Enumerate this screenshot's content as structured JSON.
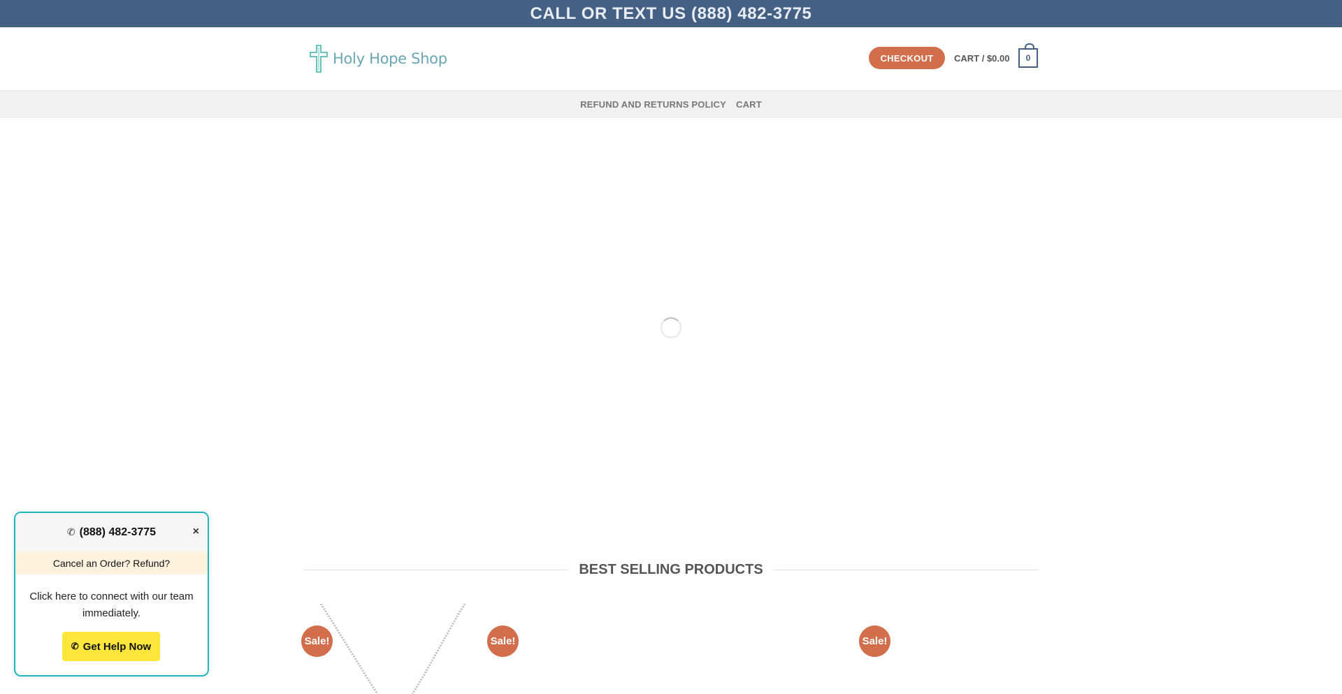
{
  "topbar": {
    "text": "CALL OR TEXT US (888) 482-3775"
  },
  "header": {
    "logo_text": "Holy Hope Shop",
    "checkout_label": "CHECKOUT",
    "cart_label": "CART / $0.00",
    "cart_count": "0"
  },
  "nav": {
    "items": [
      {
        "label": "REFUND AND RETURNS POLICY"
      },
      {
        "label": "CART"
      }
    ]
  },
  "best_selling": {
    "title": "BEST SELLING PRODUCTS",
    "sale_badges": [
      "Sale!",
      "Sale!",
      "Sale!"
    ]
  },
  "help_widget": {
    "phone": "(888) 482-3775",
    "close_label": "×",
    "subtitle": "Cancel an Order? Refund?",
    "body": "Click here to connect with our team immediately.",
    "button_label": "Get Help Now"
  },
  "colors": {
    "brand_blue": "#446084",
    "accent_orange": "#d26e4b",
    "teal": "#20b5bf",
    "help_yellow": "#ffe63b"
  }
}
